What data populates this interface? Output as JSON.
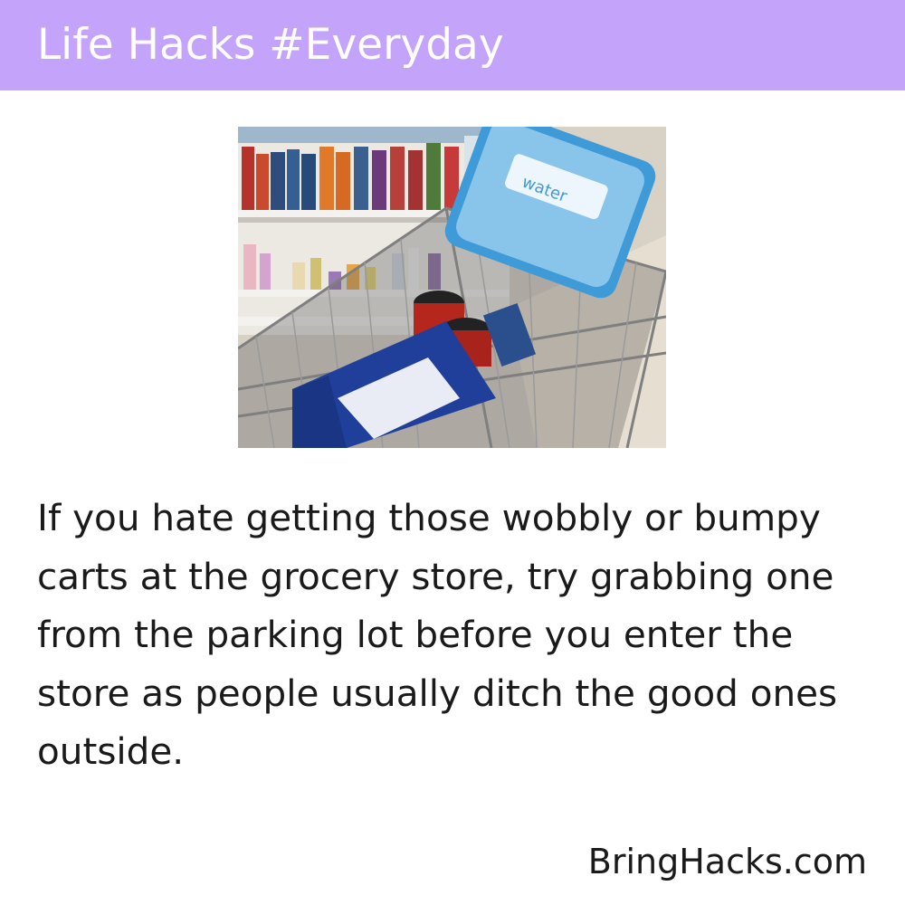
{
  "header": {
    "title": "Life Hacks #Everyday",
    "background_color": "#c4a3fa"
  },
  "photo": {
    "icon": "shopping-cart-photo",
    "water_pack_label": "water"
  },
  "tip": {
    "text": "If you hate getting those wobbly or bumpy carts at the grocery store, try grabbing one from the parking lot before you enter the store as people usually ditch the good ones outside."
  },
  "footer": {
    "site": "BringHacks.com"
  }
}
